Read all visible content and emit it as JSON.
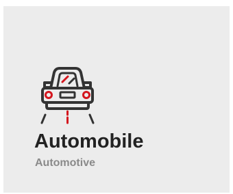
{
  "card": {
    "title": "Automobile",
    "subtitle": "Automotive",
    "icon": "car-front-icon"
  },
  "colors": {
    "card_background": "#ececec",
    "icon_stroke": "#333333",
    "icon_accent": "#d4161e",
    "title_text": "#222222",
    "subtitle_text": "#8a8a8a"
  }
}
